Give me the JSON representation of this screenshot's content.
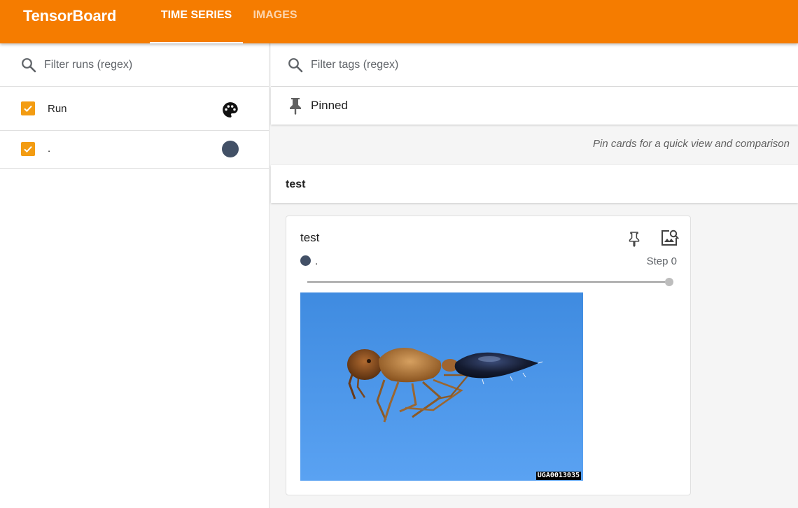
{
  "app": {
    "brand": "TensorBoard",
    "accent_color": "#f57c00",
    "tabs": [
      {
        "label": "TIME SERIES",
        "active": true
      },
      {
        "label": "IMAGES",
        "active": false
      }
    ]
  },
  "sidebar": {
    "filter_placeholder": "Filter runs (regex)",
    "filter_icon": "search-icon",
    "runs": [
      {
        "label": "Run",
        "checked": true,
        "trailing_icon": "palette-icon"
      },
      {
        "label": ".",
        "checked": true,
        "color": "#425066"
      }
    ]
  },
  "main": {
    "filter_placeholder": "Filter tags (regex)",
    "pinned": {
      "title": "Pinned",
      "icon": "pin-icon",
      "hint": "Pin cards for a quick view and comparison"
    },
    "group": {
      "title": "test"
    },
    "card": {
      "title": "test",
      "run_label": ".",
      "run_color": "#425066",
      "step_label": "Step 0",
      "slider_value": 1.0,
      "pin_icon": "pin-icon",
      "expand_icon": "image-search-icon",
      "image": {
        "subject": "ant specimen on blue background",
        "caption": "UGA0013035"
      }
    }
  }
}
